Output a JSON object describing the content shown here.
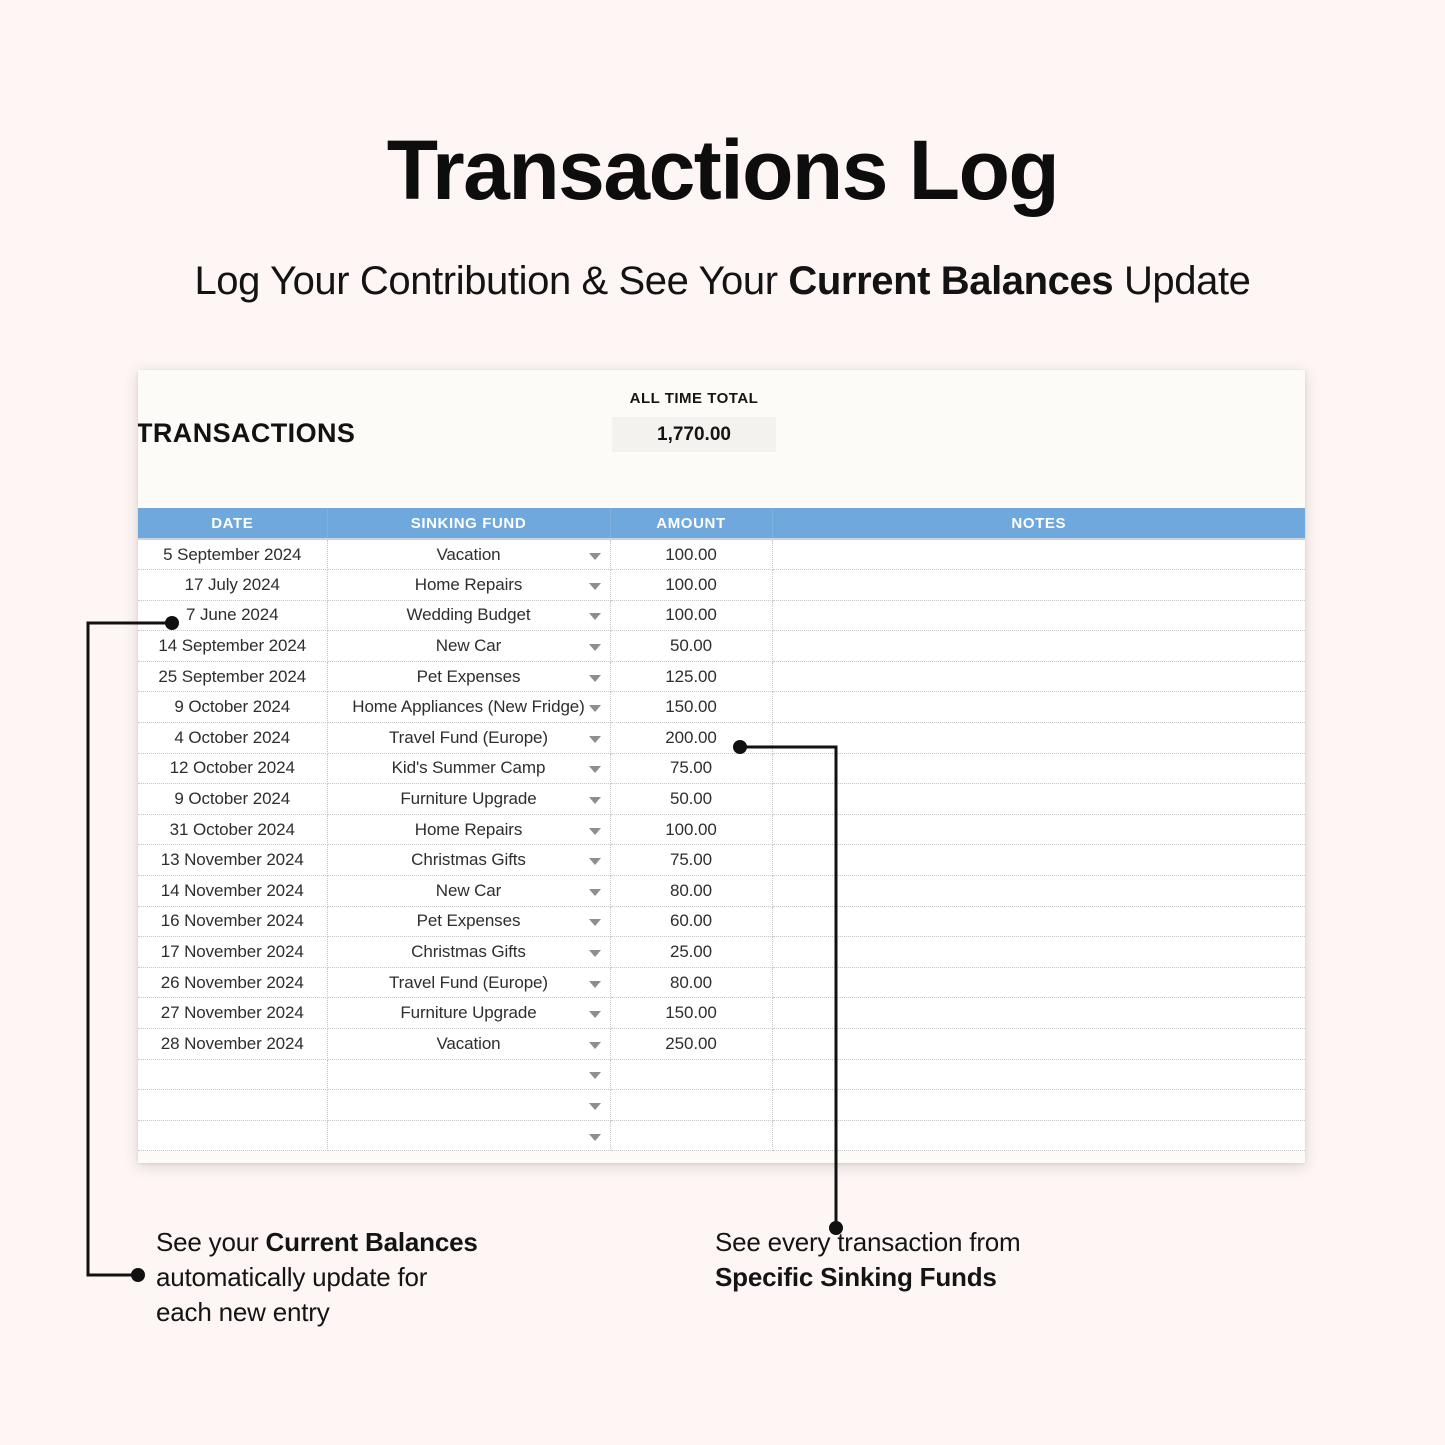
{
  "header": {
    "title": "Transactions Log",
    "subtitle_before": "Log Your Contribution & See Your ",
    "subtitle_bold": "Current Balances",
    "subtitle_after": " Update"
  },
  "sheet": {
    "name": "TRANSACTIONS",
    "total_label": "ALL TIME TOTAL",
    "total_value": "1,770.00",
    "header_color": "#6fa8dc",
    "columns": [
      "DATE",
      "SINKING FUND",
      "AMOUNT",
      "NOTES"
    ],
    "rows": [
      {
        "date": "5 September 2024",
        "fund": "Vacation",
        "amount": "100.00",
        "notes": ""
      },
      {
        "date": "17 July 2024",
        "fund": "Home Repairs",
        "amount": "100.00",
        "notes": ""
      },
      {
        "date": "7 June 2024",
        "fund": "Wedding Budget",
        "amount": "100.00",
        "notes": ""
      },
      {
        "date": "14 September 2024",
        "fund": "New Car",
        "amount": "50.00",
        "notes": ""
      },
      {
        "date": "25 September 2024",
        "fund": "Pet Expenses",
        "amount": "125.00",
        "notes": ""
      },
      {
        "date": "9 October 2024",
        "fund": "Home Appliances (New Fridge)",
        "amount": "150.00",
        "notes": ""
      },
      {
        "date": "4 October 2024",
        "fund": "Travel Fund (Europe)",
        "amount": "200.00",
        "notes": ""
      },
      {
        "date": "12 October 2024",
        "fund": "Kid's Summer Camp",
        "amount": "75.00",
        "notes": ""
      },
      {
        "date": "9 October 2024",
        "fund": "Furniture Upgrade",
        "amount": "50.00",
        "notes": ""
      },
      {
        "date": "31 October 2024",
        "fund": "Home Repairs",
        "amount": "100.00",
        "notes": ""
      },
      {
        "date": "13 November 2024",
        "fund": "Christmas Gifts",
        "amount": "75.00",
        "notes": ""
      },
      {
        "date": "14 November 2024",
        "fund": "New Car",
        "amount": "80.00",
        "notes": ""
      },
      {
        "date": "16 November 2024",
        "fund": "Pet Expenses",
        "amount": "60.00",
        "notes": ""
      },
      {
        "date": "17 November 2024",
        "fund": "Christmas Gifts",
        "amount": "25.00",
        "notes": ""
      },
      {
        "date": "26 November 2024",
        "fund": "Travel Fund (Europe)",
        "amount": "80.00",
        "notes": ""
      },
      {
        "date": "27 November 2024",
        "fund": "Furniture Upgrade",
        "amount": "150.00",
        "notes": ""
      },
      {
        "date": "28 November 2024",
        "fund": "Vacation",
        "amount": "250.00",
        "notes": ""
      },
      {
        "date": "",
        "fund": "",
        "amount": "",
        "notes": ""
      },
      {
        "date": "",
        "fund": "",
        "amount": "",
        "notes": ""
      },
      {
        "date": "",
        "fund": "",
        "amount": "",
        "notes": ""
      }
    ]
  },
  "callouts": {
    "left": {
      "line1_before": "See your ",
      "line1_bold": "Current Balances",
      "line2": "automatically update for",
      "line3": "each new entry"
    },
    "right": {
      "line1": "See every transaction from",
      "line2_bold": "Specific Sinking Funds"
    }
  }
}
